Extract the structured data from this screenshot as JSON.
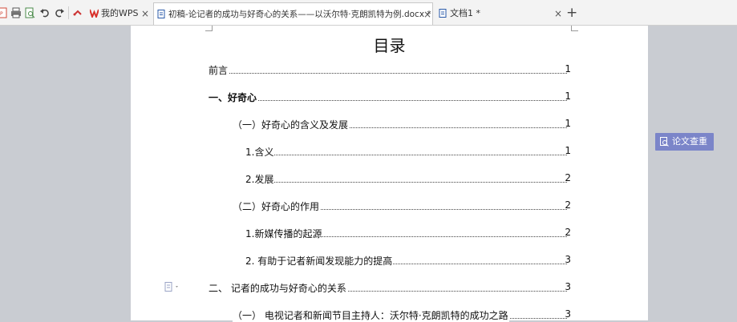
{
  "toolbar": {
    "quick_access": [
      "export-pdf-icon",
      "print-icon",
      "print-preview-icon",
      "undo-icon",
      "redo-icon"
    ]
  },
  "tabs": [
    {
      "label": "我的WPS",
      "close": "×",
      "icon": "wps-logo-icon",
      "active": false
    },
    {
      "label": "初稿-论记者的成功与好奇心的关系——以沃尔特·克朗凯特为例.docx *",
      "close": "×",
      "icon": "word-doc-icon",
      "active": true
    },
    {
      "label": "文档1 *",
      "close": "×",
      "icon": "word-doc-icon",
      "active": false
    }
  ],
  "new_tab": "+",
  "document": {
    "title": "目录",
    "toc": [
      {
        "text": "前言",
        "page": "1",
        "bold": false
      },
      {
        "text": "一、好奇心",
        "page": "1",
        "bold": true
      },
      {
        "text": "（一）好奇心的含义及发展",
        "page": "1",
        "bold": false
      },
      {
        "text": "1.含义",
        "page": "1",
        "bold": false
      },
      {
        "text": "2.发展",
        "page": "2",
        "bold": false
      },
      {
        "text": "（二）好奇心的作用",
        "page": "2",
        "bold": false
      },
      {
        "text": "1.新媒传播的起源",
        "page": "2",
        "bold": false
      },
      {
        "text": "2. 有助于记者新闻发现能力的提高",
        "page": "3",
        "bold": false
      },
      {
        "text": "二、 记者的成功与好奇心的关系",
        "page": "3",
        "bold": false
      },
      {
        "text": "（一）  电视记者和新闻节目主持人：沃尔特·克朗凯特的成功之路",
        "page": "3",
        "bold": false
      }
    ]
  },
  "paper_check_button": {
    "label": "论文查重",
    "icon": "paper-check-icon"
  },
  "colors": {
    "accent_button": "#7b85c9",
    "background": "#c9ccd2",
    "tabbar": "#f3f3f3"
  }
}
